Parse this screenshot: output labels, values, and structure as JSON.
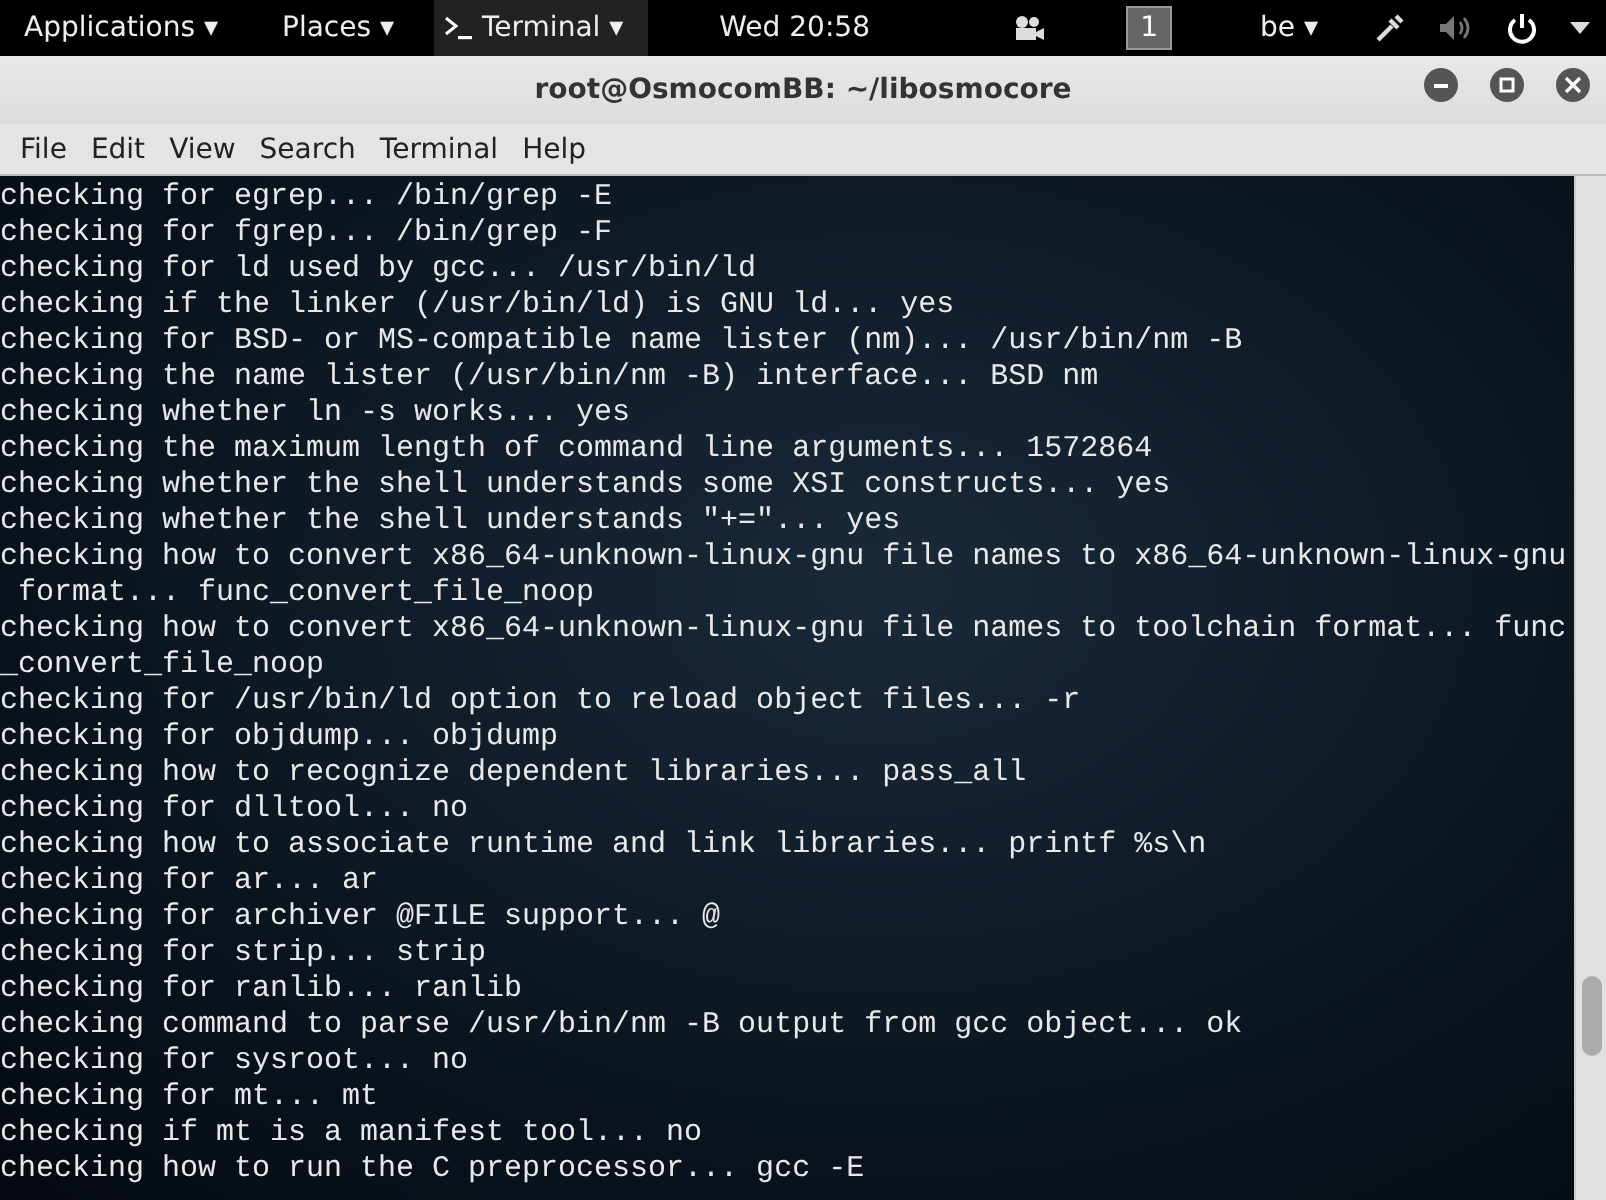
{
  "top_bar": {
    "applications": "Applications ▾",
    "places": "Places ▾",
    "active_app": "Terminal ▾",
    "clock": "Wed 20:58",
    "workspace": "1",
    "keyboard_layout": "be ▾"
  },
  "window": {
    "title": "root@OsmocomBB: ~/libosmocore"
  },
  "menu": [
    "File",
    "Edit",
    "View",
    "Search",
    "Terminal",
    "Help"
  ],
  "terminal_lines": [
    "checking for egrep... /bin/grep -E",
    "checking for fgrep... /bin/grep -F",
    "checking for ld used by gcc... /usr/bin/ld",
    "checking if the linker (/usr/bin/ld) is GNU ld... yes",
    "checking for BSD- or MS-compatible name lister (nm)... /usr/bin/nm -B",
    "checking the name lister (/usr/bin/nm -B) interface... BSD nm",
    "checking whether ln -s works... yes",
    "checking the maximum length of command line arguments... 1572864",
    "checking whether the shell understands some XSI constructs... yes",
    "checking whether the shell understands \"+=\"... yes",
    "checking how to convert x86_64-unknown-linux-gnu file names to x86_64-unknown-linux-gnu",
    " format... func_convert_file_noop",
    "checking how to convert x86_64-unknown-linux-gnu file names to toolchain format... func",
    "_convert_file_noop",
    "checking for /usr/bin/ld option to reload object files... -r",
    "checking for objdump... objdump",
    "checking how to recognize dependent libraries... pass_all",
    "checking for dlltool... no",
    "checking how to associate runtime and link libraries... printf %s\\n",
    "checking for ar... ar",
    "checking for archiver @FILE support... @",
    "checking for strip... strip",
    "checking for ranlib... ranlib",
    "checking command to parse /usr/bin/nm -B output from gcc object... ok",
    "checking for sysroot... no",
    "checking for mt... mt",
    "checking if mt is a manifest tool... no",
    "checking how to run the C preprocessor... gcc -E"
  ]
}
